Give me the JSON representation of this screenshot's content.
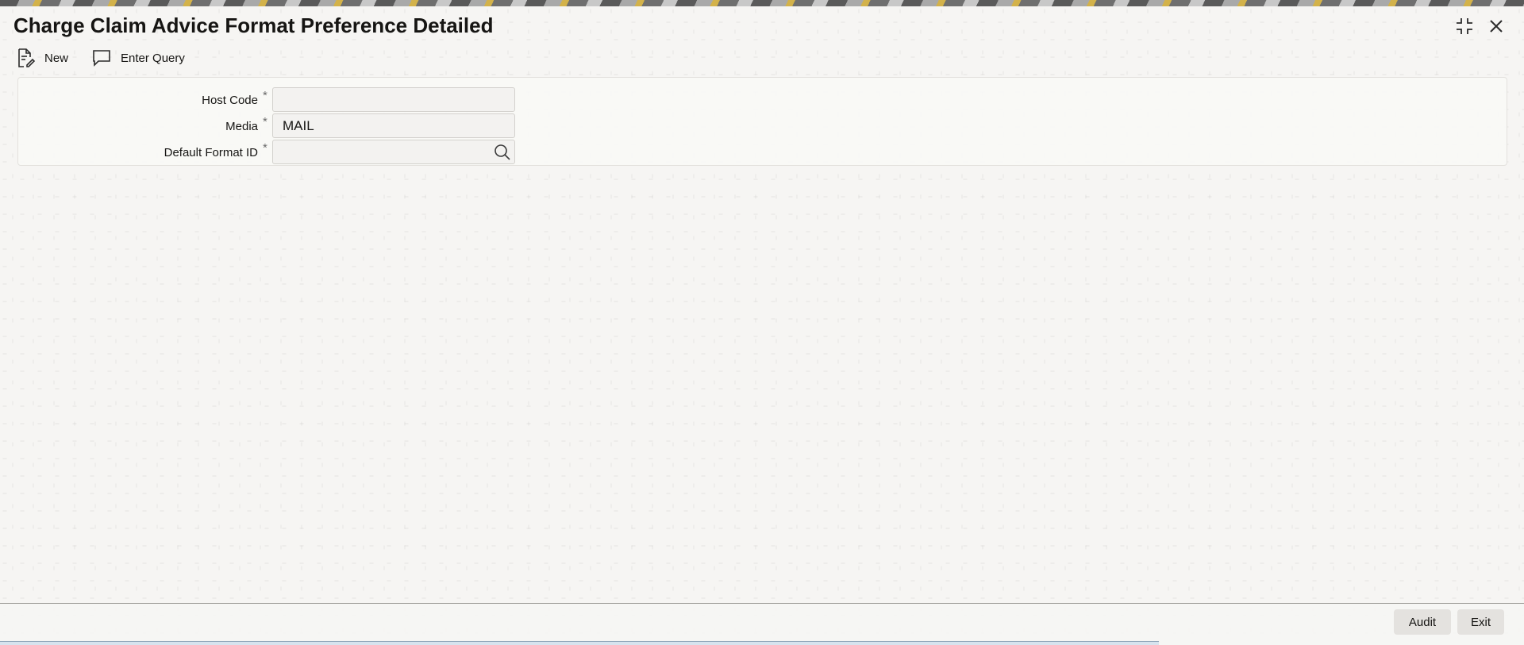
{
  "window": {
    "title": "Charge Claim Advice Format Preference Detailed",
    "controls": [
      {
        "name": "collapse-icon"
      },
      {
        "name": "close-icon"
      }
    ]
  },
  "toolbar": {
    "new_label": "New",
    "new_icon": "document-edit-icon",
    "enter_query_label": "Enter Query",
    "enter_query_icon": "speech-bubble-icon"
  },
  "form": {
    "host_code": {
      "label": "Host Code",
      "required": "*",
      "value": ""
    },
    "media": {
      "label": "Media",
      "required": "*",
      "value": "MAIL"
    },
    "default_format_id": {
      "label": "Default Format ID",
      "required": "*",
      "value": "",
      "icon": "search-icon"
    }
  },
  "footer": {
    "audit_label": "Audit",
    "exit_label": "Exit"
  }
}
